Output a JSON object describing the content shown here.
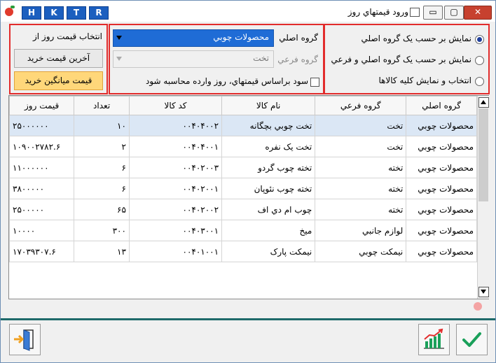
{
  "titlebar": {
    "letters": [
      "H",
      "K",
      "T",
      "R"
    ],
    "title": "ورود قيمتهاي روز",
    "minimize": "▭",
    "maximize": "▢",
    "close": "✕"
  },
  "left_panel": {
    "label": "انتخاب قیمت روز از",
    "btn_last_price": "آخرین قیمت خرید",
    "btn_avg_price": "قیمت میانگین خرید"
  },
  "mid_panel": {
    "main_group_label": "گروه اصلي",
    "main_group_value": "محصولات چوبي",
    "sub_group_label": "گروه فرعي",
    "sub_group_value": "تخت",
    "profit_checkbox_label": "سود براساس قيمتهاي، روز وارده محاسبه شود"
  },
  "right_panel": {
    "options": [
      {
        "label": "نمايش بر حسب يک گروه اصلي",
        "selected": true
      },
      {
        "label": "نمايش بر حسب يک گروه اصلي و فرعي",
        "selected": false
      },
      {
        "label": "انتخاب و نمايش کليه کالاها",
        "selected": false
      }
    ]
  },
  "table": {
    "columns": [
      "گروه اصلي",
      "گروه فرعي",
      "نام کالا",
      "کد کالا",
      "تعداد",
      "قيمت روز"
    ],
    "rows": [
      [
        "محصولات چوبي",
        "تخت",
        "تخت چوبي بچگانه",
        "۰۰۴۰۴۰۰۲",
        "۱۰",
        "۲۵۰۰۰۰۰۰"
      ],
      [
        "محصولات چوبي",
        "تخت",
        "تخت یک نفره",
        "۰۰۴۰۴۰۰۱",
        "۲",
        "۱۰۹۰۰۲۷۸۲.۶"
      ],
      [
        "محصولات چوبي",
        "تخته",
        "تخته چوب گردو",
        "۰۰۴۰۲۰۰۳",
        "۶",
        "۱۱۰۰۰۰۰۰"
      ],
      [
        "محصولات چوبي",
        "تخته",
        "تخته چوب نئوپان",
        "۰۰۴۰۲۰۰۱",
        "۶",
        "۳۸۰۰۰۰۰"
      ],
      [
        "محصولات چوبي",
        "تخته",
        "چوب ام دي اف",
        "۰۰۴۰۲۰۰۲",
        "۶۵",
        "۲۵۰۰۰۰۰"
      ],
      [
        "محصولات چوبي",
        "لوازم جانبي",
        "ميخ",
        "۰۰۴۰۳۰۰۱",
        "۳۰۰",
        "۱۰۰۰۰"
      ],
      [
        "محصولات چوبي",
        "نيمکت چوبي",
        "نيمکت پارک",
        "۰۰۴۰۱۰۰۱",
        "۱۳",
        "۱۷۰۳۹۳۰۷.۶"
      ]
    ]
  },
  "icons": {
    "exit": "exit-door-icon",
    "chart": "bar-chart-icon",
    "confirm": "checkmark-icon"
  },
  "colors": {
    "highlight_border": "#e22c2c",
    "selected_blue": "#1f6cd6",
    "avg_button": "#ffd77a",
    "confirm_green": "#1aa05a"
  }
}
